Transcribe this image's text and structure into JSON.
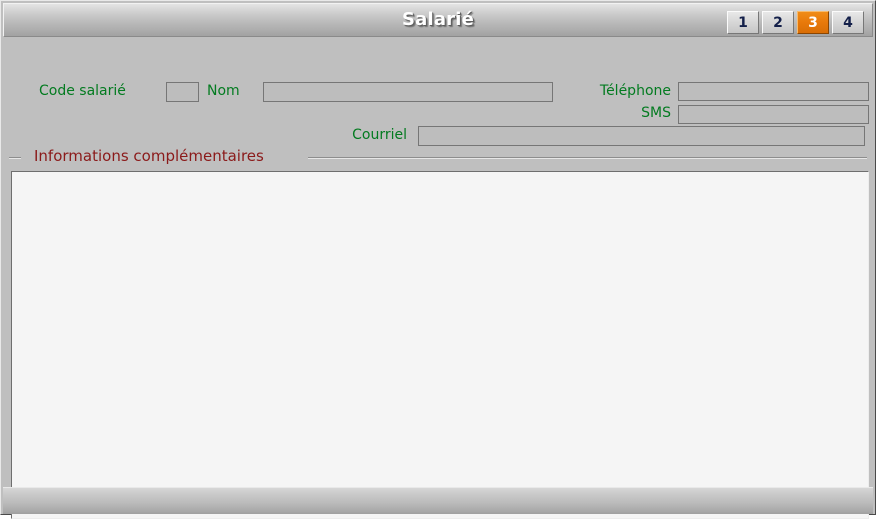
{
  "window": {
    "title": "Salarié"
  },
  "tabs": [
    {
      "label": "1",
      "active": false
    },
    {
      "label": "2",
      "active": false
    },
    {
      "label": "3",
      "active": true
    },
    {
      "label": "4",
      "active": false
    }
  ],
  "form": {
    "code_salarie": {
      "label": "Code salarié",
      "value": "",
      "placeholder": ""
    },
    "nom": {
      "label": "Nom",
      "value": "",
      "placeholder": ""
    },
    "telephone": {
      "label": "Téléphone",
      "value": "",
      "placeholder": ""
    },
    "sms": {
      "label": "SMS",
      "value": "",
      "placeholder": ""
    },
    "courriel": {
      "label": "Courriel",
      "value": "",
      "placeholder": ""
    }
  },
  "section": {
    "title": "Informations complémentaires",
    "content": ""
  },
  "colors": {
    "label_green": "#037b20",
    "section_maroon": "#8b1a1a",
    "active_tab_orange": "#e8790a",
    "window_gray": "#bfbfbf",
    "pane_background": "#f5f5f5"
  }
}
